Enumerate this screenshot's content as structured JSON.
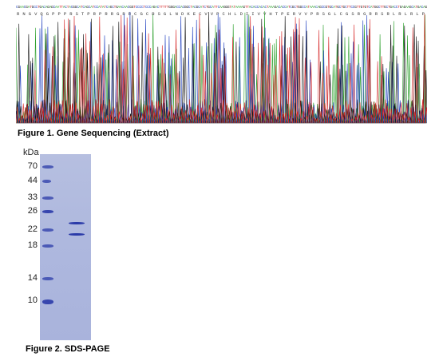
{
  "figure1": {
    "caption": "Figure 1. Gene Sequencing (Extract)",
    "protein_sequence": "RNGVQGPPPRSTPRPRRGRRCGCRSGLNDKECVVPCHLDIIVVHTPERVVPRSGLCGSRGRRSRLRLRLP",
    "trace_colors": {
      "A": "#2ca02c",
      "C": "#1f3fbf",
      "G": "#111111",
      "T": "#d62728"
    }
  },
  "figure2": {
    "caption": "Figure 2. SDS-PAGE",
    "unit_label": "kDa",
    "markers": [
      "70",
      "44",
      "33",
      "26",
      "22",
      "18",
      "14",
      "10"
    ],
    "sample_bands_kda": [
      23.5,
      21.0
    ],
    "gel_color": "#afb8de",
    "band_color": "#2a3aa8"
  }
}
